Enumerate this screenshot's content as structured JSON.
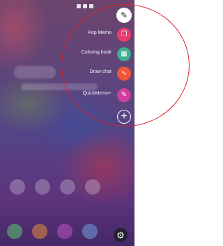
{
  "quick_menu": {
    "items": [
      {
        "label": "Pop Memo",
        "icon": "pop-memo-icon",
        "color": "#e63c6e"
      },
      {
        "label": "Coloring book",
        "icon": "coloring-book-icon",
        "color": "#3cae91"
      },
      {
        "label": "Draw chat",
        "icon": "draw-chat-icon",
        "color": "#f2553a"
      },
      {
        "label": "QuickMemo+",
        "icon": "quickmemo-icon",
        "color": "#cc3f9a"
      }
    ],
    "top_icon": "pen-icon",
    "add_icon": "plus-icon"
  },
  "settings_icon": "gear-icon",
  "highlight_color": "#e0202a"
}
